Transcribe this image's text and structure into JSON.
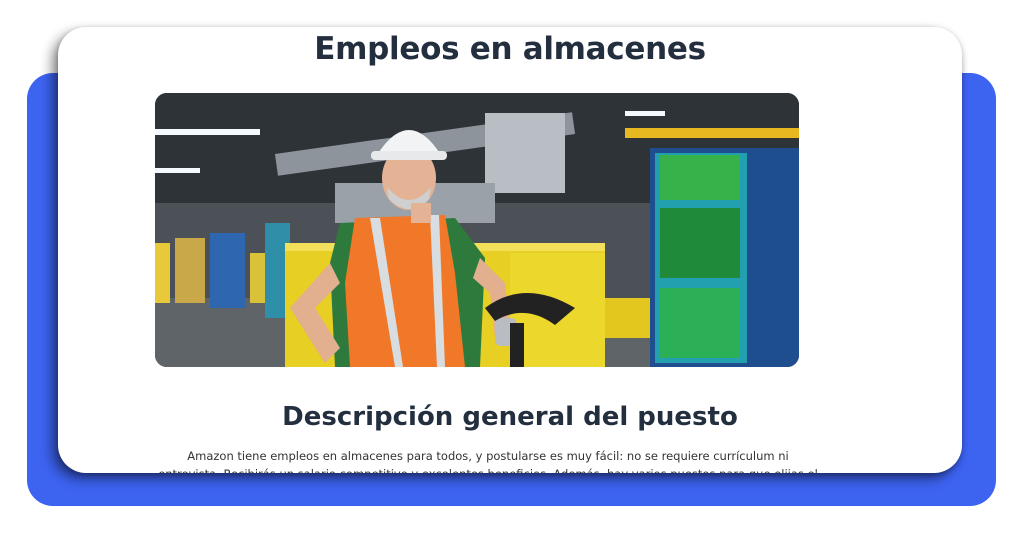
{
  "page": {
    "title": "Empleos en almacenes",
    "section_title": "Descripción general del puesto",
    "paragraph": "Amazon tiene empleos en almacenes para todos, y postularse es muy fácil: no se requiere currículum ni entrevista. Recibirás un salario competitivo y excelentes beneficios. Además, hay varios puestos para que elijas el que mejor se"
  },
  "colors": {
    "backdrop": "#3d63f1",
    "heading": "#232f3e"
  },
  "hero_image": {
    "subject": "warehouse worker in hard hat and orange safety vest with pallet jack"
  }
}
